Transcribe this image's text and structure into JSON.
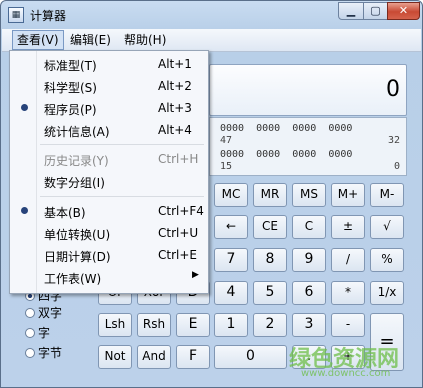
{
  "window": {
    "title": "计算器",
    "app_icon_glyph": "▦"
  },
  "window_controls": {
    "minimize": "▁",
    "maximize": "▢",
    "close": "✕"
  },
  "menubar": {
    "view": "查看(V)",
    "edit": "编辑(E)",
    "help": "帮助(H)"
  },
  "display": {
    "value": "0"
  },
  "bits": {
    "row1": "0000  0000  0000  0000",
    "row1_labels": [
      "47",
      "32"
    ],
    "row2": "0000  0000  0000  0000",
    "row2_labels": [
      "15",
      "0"
    ]
  },
  "keys": {
    "mc": "MC",
    "mr": "MR",
    "ms": "MS",
    "mplus": "M+",
    "mminus": "M-",
    "backspace": "←",
    "ce": "CE",
    "c": "C",
    "plusminus": "±",
    "sqrt": "√",
    "seven": "7",
    "eight": "8",
    "nine": "9",
    "divide": "/",
    "percent": "%",
    "four": "4",
    "five": "5",
    "six": "6",
    "multiply": "*",
    "reciprocal": "1/x",
    "one": "1",
    "two": "2",
    "three": "3",
    "minus": "-",
    "equals": "=",
    "zero": "0",
    "dot": ".",
    "plus": "+",
    "hex_d": "D",
    "hex_e": "E",
    "hex_f": "F",
    "or": "Or",
    "xor": "Xor",
    "lsh": "Lsh",
    "rsh": "Rsh",
    "not": "Not",
    "and": "And"
  },
  "word_size": {
    "options": [
      "四字",
      "双字",
      "字",
      "字节"
    ],
    "selected": "四字"
  },
  "view_menu": {
    "items": [
      {
        "label": "标准型(T)",
        "shortcut": "Alt+1",
        "checked": false
      },
      {
        "label": "科学型(S)",
        "shortcut": "Alt+2",
        "checked": false
      },
      {
        "label": "程序员(P)",
        "shortcut": "Alt+3",
        "checked": true
      },
      {
        "label": "统计信息(A)",
        "shortcut": "Alt+4",
        "checked": false
      },
      {
        "label": "历史记录(Y)",
        "shortcut": "Ctrl+H",
        "checked": false,
        "disabled": true
      },
      {
        "label": "数字分组(I)",
        "shortcut": "",
        "checked": false
      },
      {
        "label": "基本(B)",
        "shortcut": "Ctrl+F4",
        "checked": true
      },
      {
        "label": "单位转换(U)",
        "shortcut": "Ctrl+U",
        "checked": false
      },
      {
        "label": "日期计算(D)",
        "shortcut": "Ctrl+E",
        "checked": false
      },
      {
        "label": "工作表(W)",
        "shortcut": "",
        "checked": false,
        "submenu": true
      }
    ]
  },
  "watermark": {
    "text": "绿色资源网",
    "url": "www.downcc.com"
  }
}
